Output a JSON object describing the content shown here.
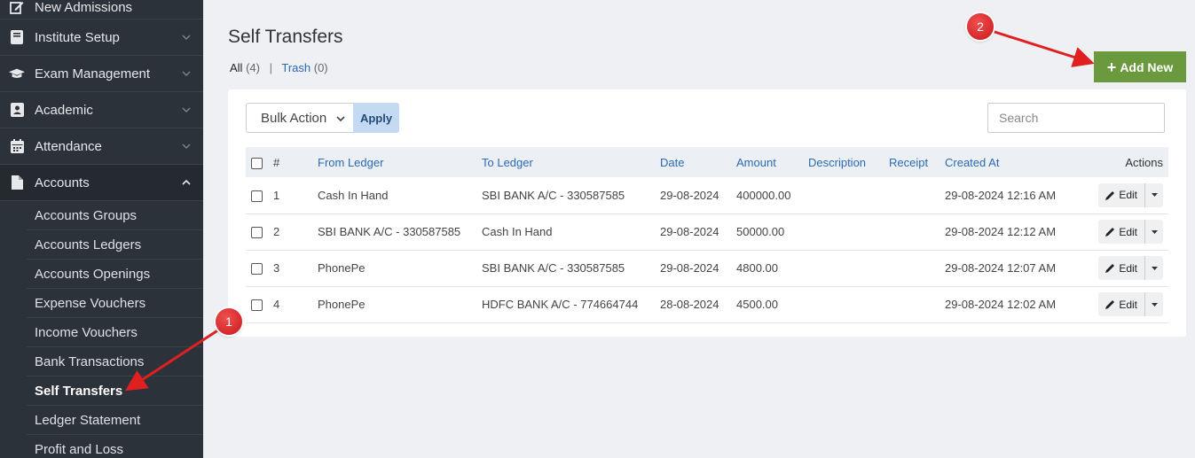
{
  "sidebar": {
    "items": [
      {
        "label": "New Admissions",
        "icon": "edit-icon"
      },
      {
        "label": "Institute Setup",
        "icon": "book-icon"
      },
      {
        "label": "Exam Management",
        "icon": "graduation-cap-icon"
      },
      {
        "label": "Academic",
        "icon": "id-card-icon"
      },
      {
        "label": "Attendance",
        "icon": "calendar-icon"
      },
      {
        "label": "Accounts",
        "icon": "file-icon"
      }
    ],
    "sub_items": [
      {
        "label": "Accounts Groups"
      },
      {
        "label": "Accounts Ledgers"
      },
      {
        "label": "Accounts Openings"
      },
      {
        "label": "Expense Vouchers"
      },
      {
        "label": "Income Vouchers"
      },
      {
        "label": "Bank Transactions"
      },
      {
        "label": "Self Transfers"
      },
      {
        "label": "Ledger Statement"
      },
      {
        "label": "Profit and Loss"
      }
    ]
  },
  "page": {
    "title": "Self Transfers",
    "filter_all": "All",
    "filter_all_count": "(4)",
    "filter_sep": "|",
    "filter_trash": "Trash",
    "filter_trash_count": "(0)",
    "add_new_label": "Add New"
  },
  "toolbar": {
    "bulk_action": "Bulk Action",
    "apply": "Apply",
    "search_placeholder": "Search"
  },
  "table": {
    "columns": [
      "#",
      "From Ledger",
      "To Ledger",
      "Date",
      "Amount",
      "Description",
      "Receipt",
      "Created At",
      "Actions"
    ],
    "rows": [
      {
        "num": "1",
        "from": "Cash In Hand",
        "to": "SBI BANK A/C - 330587585",
        "date": "29-08-2024",
        "amount": "400000.00",
        "description": "",
        "receipt": "",
        "created": "29-08-2024 12:16 AM"
      },
      {
        "num": "2",
        "from": "SBI BANK A/C - 330587585",
        "to": "Cash In Hand",
        "date": "29-08-2024",
        "amount": "50000.00",
        "description": "",
        "receipt": "",
        "created": "29-08-2024 12:12 AM"
      },
      {
        "num": "3",
        "from": "PhonePe",
        "to": "SBI BANK A/C - 330587585",
        "date": "29-08-2024",
        "amount": "4800.00",
        "description": "",
        "receipt": "",
        "created": "29-08-2024 12:07 AM"
      },
      {
        "num": "4",
        "from": "PhonePe",
        "to": "HDFC BANK A/C - 774664744",
        "date": "28-08-2024",
        "amount": "4500.00",
        "description": "",
        "receipt": "",
        "created": "29-08-2024 12:02 AM"
      }
    ],
    "edit_label": "Edit"
  },
  "annotations": {
    "badge_1": "1",
    "badge_2": "2"
  },
  "colors": {
    "sidebar_bg": "#2c323a",
    "accent_green": "#6b9a3e",
    "link_blue": "#2a6ab5",
    "annotation_red": "#e02020"
  }
}
